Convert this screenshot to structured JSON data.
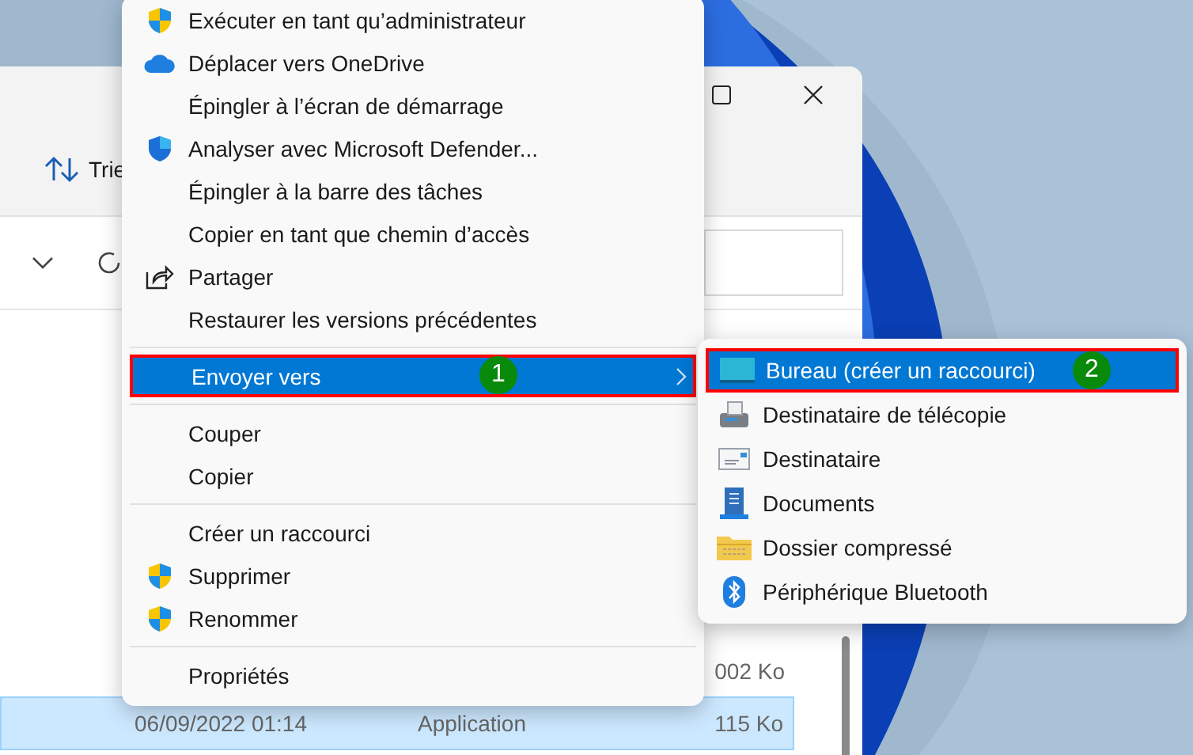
{
  "explorer": {
    "toolbar": {
      "sort_label": "Trie"
    },
    "file_rows": [
      {
        "date": "",
        "type": "",
        "size": "002 Ko",
        "selected": false
      },
      {
        "date": "06/09/2022 01:14",
        "type": "Application",
        "size": "115 Ko",
        "selected": true
      }
    ]
  },
  "context_menu": {
    "groups": [
      [
        {
          "label": "Exécuter en tant qu’administrateur",
          "kind": "uac",
          "selected": false
        },
        {
          "label": "Déplacer vers OneDrive",
          "kind": "cloud",
          "selected": false
        },
        {
          "label": "Épingler à l’écran de démarrage",
          "selected": false
        },
        {
          "label": "Analyser avec Microsoft Defender...",
          "kind": "defender",
          "selected": false
        },
        {
          "label": "Épingler à la barre des tâches",
          "selected": false
        },
        {
          "label": "Copier en tant que chemin d’accès",
          "selected": false
        },
        {
          "label": "Partager",
          "kind": "share",
          "selected": false
        },
        {
          "label": "Restaurer les versions précédentes",
          "selected": false
        }
      ],
      [
        {
          "label": "Envoyer vers",
          "selected": true,
          "has_submenu": true,
          "badge": "1"
        }
      ],
      [
        {
          "label": "Couper",
          "selected": false
        },
        {
          "label": "Copier",
          "selected": false
        }
      ],
      [
        {
          "label": "Créer un raccourci",
          "selected": false
        },
        {
          "label": "Supprimer",
          "kind": "uac",
          "selected": false
        },
        {
          "label": "Renommer",
          "kind": "uac",
          "selected": false
        }
      ],
      [
        {
          "label": "Propriétés",
          "selected": false
        }
      ]
    ]
  },
  "submenu": {
    "items": [
      {
        "label": "Bureau (créer un raccourci)",
        "kind": "desktop",
        "selected": true,
        "badge": "2"
      },
      {
        "label": "Destinataire de télécopie",
        "kind": "fax",
        "selected": false
      },
      {
        "label": "Destinataire",
        "kind": "mail",
        "selected": false
      },
      {
        "label": "Documents",
        "kind": "document",
        "selected": false
      },
      {
        "label": "Dossier compressé",
        "kind": "zip",
        "selected": false
      },
      {
        "label": "Périphérique Bluetooth",
        "kind": "bluetooth",
        "selected": false
      }
    ]
  }
}
